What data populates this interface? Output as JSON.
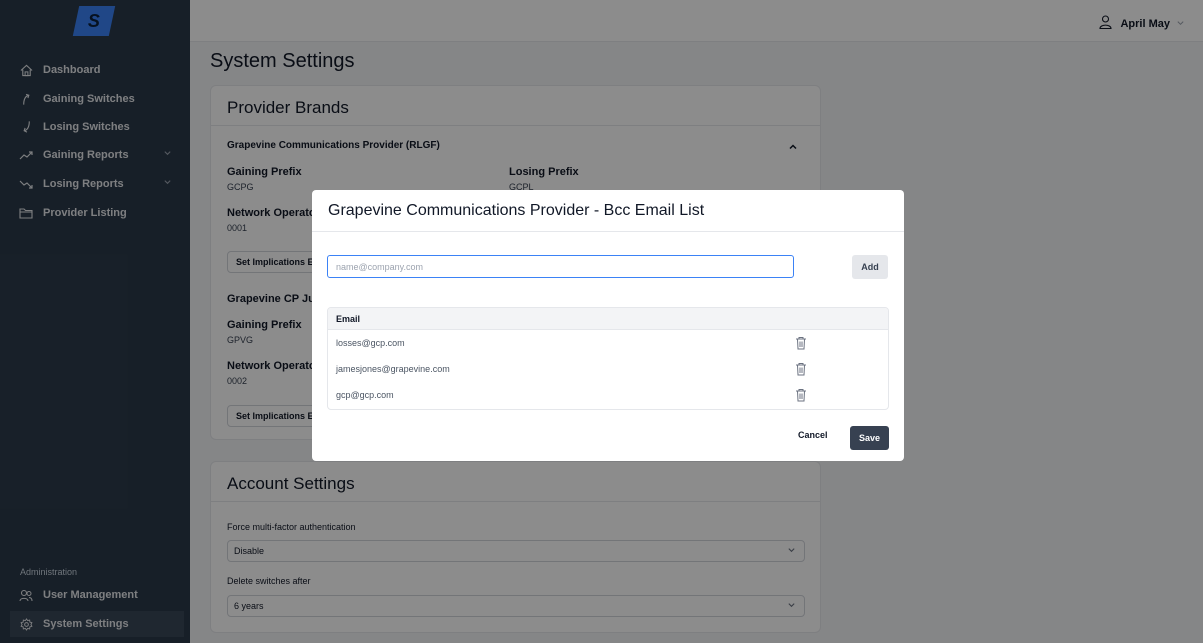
{
  "logo": {
    "letter": "S"
  },
  "sidebar": {
    "items": [
      {
        "label": "Dashboard",
        "icon": "home-icon"
      },
      {
        "label": "Gaining Switches",
        "icon": "arrow-up-curve-icon"
      },
      {
        "label": "Losing Switches",
        "icon": "arrow-down-curve-icon"
      },
      {
        "label": "Gaining Reports",
        "icon": "trend-up-icon",
        "expandable": true
      },
      {
        "label": "Losing Reports",
        "icon": "trend-down-icon",
        "expandable": true
      },
      {
        "label": "Provider Listing",
        "icon": "folder-icon"
      }
    ],
    "admin_heading": "Administration",
    "admin_items": [
      {
        "label": "User Management",
        "icon": "users-icon"
      },
      {
        "label": "System Settings",
        "icon": "gear-icon",
        "active": true
      }
    ]
  },
  "topbar": {
    "user_name": "April May"
  },
  "page": {
    "title": "System Settings"
  },
  "provider_brands": {
    "title": "Provider Brands",
    "brand1": {
      "name": "Grapevine Communications Provider (RLGF)",
      "gaining_prefix_label": "Gaining Prefix",
      "gaining_prefix": "GCPG",
      "losing_prefix_label": "Losing Prefix",
      "losing_prefix": "GCPL",
      "network_operator_label": "Network Operator",
      "network_operator": "0001",
      "button": "Set Implications Email List"
    },
    "brand2": {
      "name": "Grapevine CP Junior",
      "gaining_prefix_label": "Gaining Prefix",
      "gaining_prefix": "GPVG",
      "network_operator_label": "Network Operator",
      "network_operator": "0002",
      "button": "Set Implications Email List"
    }
  },
  "account_settings": {
    "title": "Account Settings",
    "mfa_label": "Force multi-factor authentication",
    "mfa_value": "Disable",
    "delete_label": "Delete switches after",
    "delete_value": "6 years"
  },
  "modal": {
    "title": "Grapevine Communications Provider - Bcc Email List",
    "input_placeholder": "name@company.com",
    "input_value": "",
    "add_label": "Add",
    "column_email": "Email",
    "emails": [
      "losses@gcp.com",
      "jamesjones@grapevine.com",
      "gcp@gcp.com"
    ],
    "cancel_label": "Cancel",
    "save_label": "Save"
  },
  "colors": {
    "accent": "#3b82f6",
    "sidebar": "#2b3a4a",
    "save": "#374151"
  }
}
